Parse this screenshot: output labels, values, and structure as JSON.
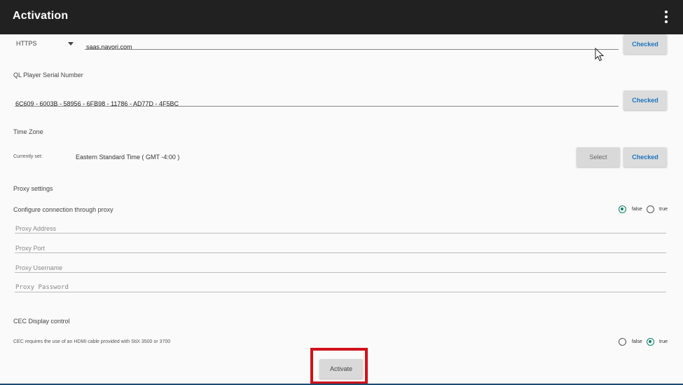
{
  "app": {
    "title": "Activation"
  },
  "server": {
    "protocol": "HTTPS",
    "url": "saas.navori.com",
    "status_label": "Checked"
  },
  "serial": {
    "label": "QL Player Serial Number",
    "value": "6C609 - 6003B - 58956 - 6FB98 - 11786 - AD77D - 4F5BC",
    "status_label": "Checked"
  },
  "timezone": {
    "label": "Time Zone",
    "current_label": "Currently set:",
    "value": "Eastern Standard Time ( GMT -4:00 )",
    "select_label": "Select",
    "status_label": "Checked"
  },
  "proxy": {
    "section_label": "Proxy settings",
    "configure_label": "Configure connection through proxy",
    "false_label": "false",
    "true_label": "true",
    "selected": "false",
    "address_placeholder": "Proxy Address",
    "port_placeholder": "Proxy Port",
    "username_placeholder": "Proxy Username",
    "password_placeholder": "Proxy Password"
  },
  "cec": {
    "label": "CEC Display control",
    "note": "CEC requires the use of an HDMI cable provided with StiX 3500 or 3700",
    "false_label": "false",
    "true_label": "true",
    "selected": "true"
  },
  "actions": {
    "activate_label": "Activate"
  },
  "colors": {
    "topbar": "#212121",
    "accent": "#0f7d6a",
    "link": "#1e73be",
    "highlight": "#d0111b"
  }
}
